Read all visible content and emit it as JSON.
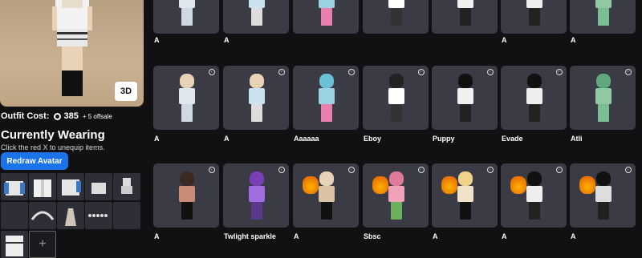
{
  "left_panel": {
    "view_3d_label": "3D",
    "outfit_cost_label": "Outfit Cost:",
    "outfit_cost_value": "385",
    "offsale_label": "+ 5 offsale",
    "currently_wearing_title": "Currently Wearing",
    "currently_wearing_hint": "Click the red X to unequip items.",
    "redraw_button_label": "Redraw Avatar",
    "add_item_icon": "plus-icon"
  },
  "outfits": {
    "row_top_labels": [
      "A",
      "A",
      "",
      "",
      "",
      "A",
      "A"
    ],
    "row_middle": [
      {
        "name": "A"
      },
      {
        "name": "A"
      },
      {
        "name": "Aaaaaa"
      },
      {
        "name": "Eboy"
      },
      {
        "name": "Puppy"
      },
      {
        "name": "Evade"
      },
      {
        "name": "Atli"
      }
    ],
    "row_bottom": [
      {
        "name": "A"
      },
      {
        "name": "Twlight sparkle"
      },
      {
        "name": "A"
      },
      {
        "name": "Sbsc"
      },
      {
        "name": "A"
      },
      {
        "name": "A"
      },
      {
        "name": "A"
      }
    ],
    "settings_icon": "gear-icon"
  },
  "colors": {
    "background": "#111114",
    "card": "#3a3b45",
    "accent_blue": "#1a73e8"
  }
}
